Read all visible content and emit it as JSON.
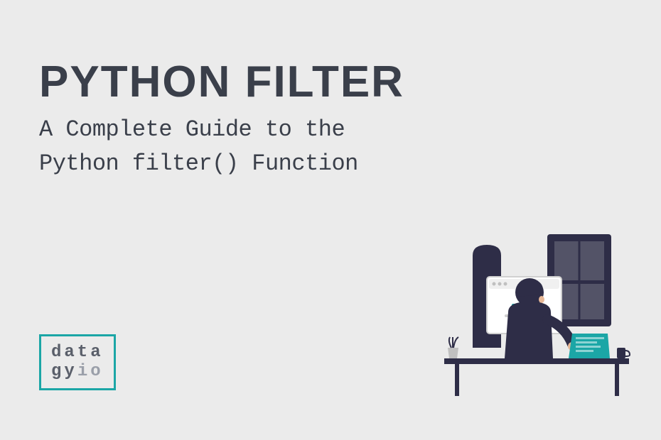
{
  "title": "PYTHON FILTER",
  "subtitle_line1": "A Complete Guide to the",
  "subtitle_line2": "Python filter() Function",
  "logo": {
    "line1": "data",
    "line2_part1": "gy",
    "line2_part2": "io"
  },
  "colors": {
    "background": "#ebebeb",
    "text_primary": "#3a3f4a",
    "accent": "#1ba6a6",
    "illustration_dark": "#2e2d47"
  }
}
